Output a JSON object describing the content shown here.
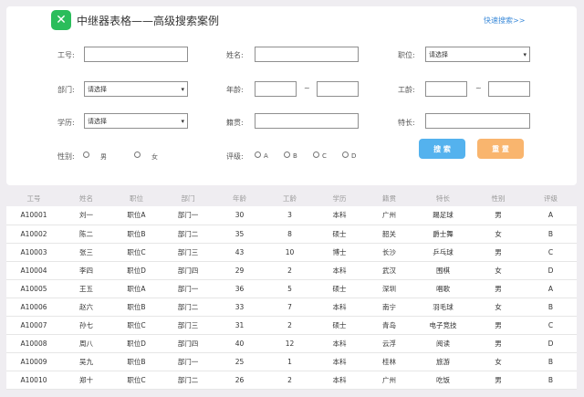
{
  "header": {
    "logo_glyph": "✕",
    "title": "中继器表格——高级搜索案例",
    "quick_search_link": "快速搜索>>"
  },
  "form": {
    "emp_id": {
      "label": "工号:",
      "value": ""
    },
    "name": {
      "label": "姓名:",
      "value": ""
    },
    "position": {
      "label": "职位:",
      "selected": "请选择"
    },
    "dept": {
      "label": "部门:",
      "selected": "请选择"
    },
    "age": {
      "label": "年龄:",
      "min": "",
      "max": "",
      "sep": "~"
    },
    "tenure": {
      "label": "工龄:",
      "min": "",
      "max": "",
      "sep": "~"
    },
    "education": {
      "label": "学历:",
      "selected": "请选择"
    },
    "hometown": {
      "label": "籍贯:",
      "value": ""
    },
    "specialty": {
      "label": "特长:",
      "value": ""
    },
    "gender": {
      "label": "性别:",
      "options": [
        "男",
        "女"
      ]
    },
    "grade": {
      "label": "评级:",
      "options": [
        "A",
        "B",
        "C",
        "D"
      ]
    },
    "search_button": "搜 索",
    "reset_button": "重 置"
  },
  "table": {
    "columns": [
      "工号",
      "姓名",
      "职位",
      "部门",
      "年龄",
      "工龄",
      "学历",
      "籍贯",
      "特长",
      "性别",
      "评级"
    ],
    "rows": [
      [
        "A10001",
        "刘一",
        "职位A",
        "部门一",
        "30",
        "3",
        "本科",
        "广州",
        "踢足球",
        "男",
        "A"
      ],
      [
        "A10002",
        "陈二",
        "职位B",
        "部门二",
        "35",
        "8",
        "硕士",
        "韶关",
        "爵士舞",
        "女",
        "B"
      ],
      [
        "A10003",
        "张三",
        "职位C",
        "部门三",
        "43",
        "10",
        "博士",
        "长沙",
        "乒乓球",
        "男",
        "C"
      ],
      [
        "A10004",
        "李四",
        "职位D",
        "部门四",
        "29",
        "2",
        "本科",
        "武汉",
        "围棋",
        "女",
        "D"
      ],
      [
        "A10005",
        "王五",
        "职位A",
        "部门一",
        "36",
        "5",
        "硕士",
        "深圳",
        "唱歌",
        "男",
        "A"
      ],
      [
        "A10006",
        "赵六",
        "职位B",
        "部门二",
        "33",
        "7",
        "本科",
        "南宁",
        "羽毛球",
        "女",
        "B"
      ],
      [
        "A10007",
        "孙七",
        "职位C",
        "部门三",
        "31",
        "2",
        "硕士",
        "青岛",
        "电子竞技",
        "男",
        "C"
      ],
      [
        "A10008",
        "周八",
        "职位D",
        "部门四",
        "40",
        "12",
        "本科",
        "云浮",
        "阅读",
        "男",
        "D"
      ],
      [
        "A10009",
        "吴九",
        "职位B",
        "部门一",
        "25",
        "1",
        "本科",
        "桂林",
        "旅游",
        "女",
        "B"
      ],
      [
        "A10010",
        "郑十",
        "职位C",
        "部门二",
        "26",
        "2",
        "本科",
        "广州",
        "吃饭",
        "男",
        "B"
      ]
    ]
  },
  "colors": {
    "accent_green": "#2bbd5b",
    "search_blue": "#54b2ee",
    "reset_orange": "#f9b56e",
    "link_blue": "#3d8bd9"
  }
}
